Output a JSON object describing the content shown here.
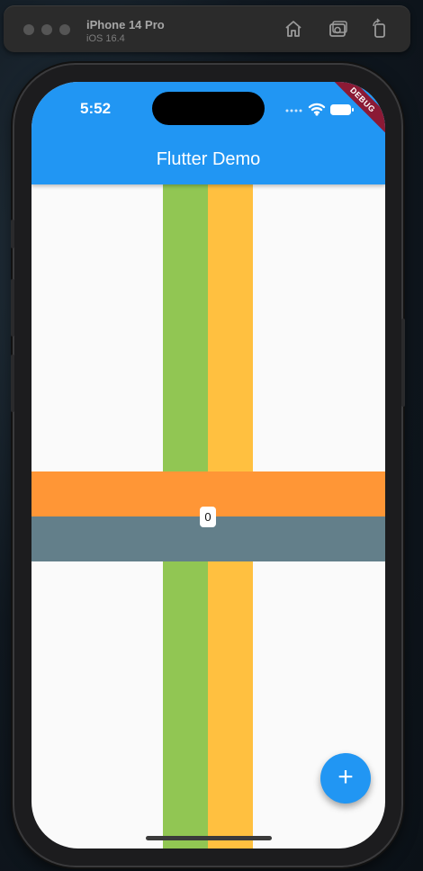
{
  "simulator": {
    "device_name": "iPhone 14 Pro",
    "os_version": "iOS 16.4",
    "buttons": [
      "home-icon",
      "screenshot-icon",
      "rotate-icon"
    ]
  },
  "status_bar": {
    "time": "5:52"
  },
  "app_bar": {
    "title": "Flutter Demo",
    "color": "#2196f3"
  },
  "debug_banner": {
    "label": "DEBUG",
    "color": "#8b1a35"
  },
  "content": {
    "counter_value": "0",
    "colors": {
      "green": "#8bc34a",
      "yellow": "#ffc040",
      "orange": "#ff9636",
      "grey": "#637f8a"
    }
  },
  "fab": {
    "label": "+",
    "icon": "add-icon"
  }
}
